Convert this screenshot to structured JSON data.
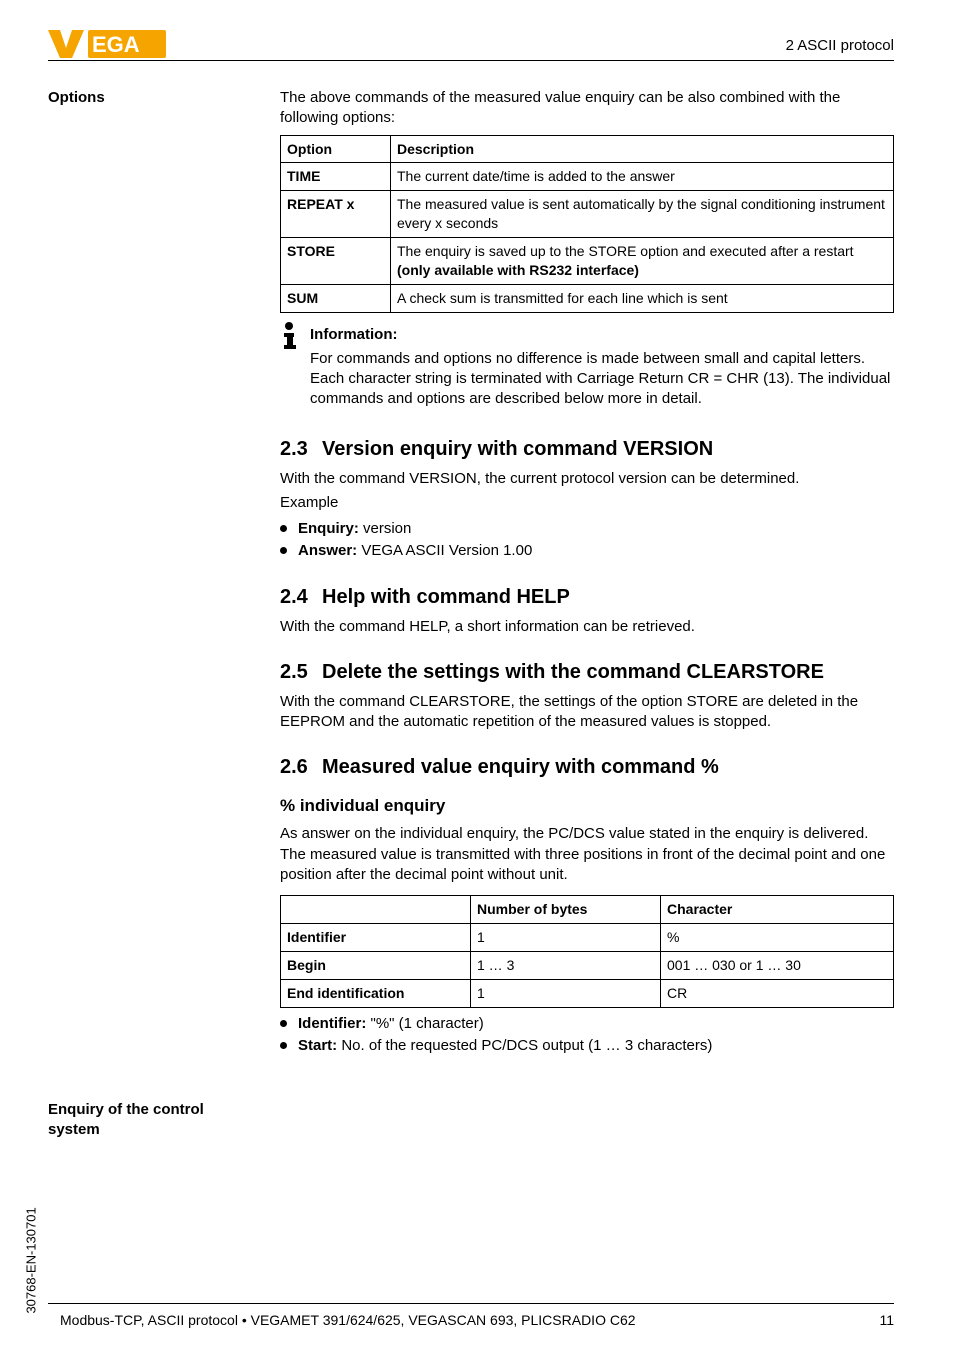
{
  "header": {
    "section_label": "2 ASCII protocol"
  },
  "doc_id": "30768-EN-130701",
  "margin": {
    "options": "Options",
    "enquiry": "Enquiry of the control system"
  },
  "options_intro": "The above commands of the measured value enquiry can be also combined with the following options:",
  "options_table": {
    "h1": "Option",
    "h2": "Description",
    "rows": [
      {
        "opt": "TIME",
        "desc": "The current date/time is added to the answer"
      },
      {
        "opt": "REPEAT x",
        "desc": "The measured value is sent automatically by the signal conditioning instrument every x seconds"
      },
      {
        "opt": "STORE",
        "desc": "The enquiry is saved up to the STORE option and executed after a restart (only available with RS232 interface)"
      },
      {
        "opt": "SUM",
        "desc": "A check sum is transmitted for each line which is sent"
      }
    ],
    "store_plain": "The enquiry is saved up to the STORE option and executed after a restart ",
    "store_bold": "(only available with RS232 interface)"
  },
  "info": {
    "heading": "Information:",
    "body": "For commands and options no difference is made between small and capital letters. Each character string is terminated with Carriage Return CR = CHR (13). The individual commands and options are described below more in detail."
  },
  "s23": {
    "num": "2.3",
    "title": "Version enquiry with command VERSION",
    "p1": "With the command VERSION, the current protocol version can be determined.",
    "p2": "Example",
    "b1_label": "Enquiry:",
    "b1_val": " version",
    "b2_label": "Answer:",
    "b2_val": " VEGA ASCII Version 1.00"
  },
  "s24": {
    "num": "2.4",
    "title": "Help with command HELP",
    "p1": "With the command HELP, a short information can be retrieved."
  },
  "s25": {
    "num": "2.5",
    "title": "Delete the settings with the command CLEARSTORE",
    "p1": "With the command CLEARSTORE, the settings of the option STORE are deleted in the EEPROM and the automatic repetition of the measured values is stopped."
  },
  "s26": {
    "num": "2.6",
    "title": "Measured value enquiry with command %",
    "sub": "% individual enquiry",
    "p1": "As answer on the individual enquiry, the PC/DCS value stated in the enquiry is delivered. The measured value is transmitted with three positions in front of the decimal point and one position after the decimal point without unit."
  },
  "enq_table": {
    "h_blank": "",
    "h2": "Number of bytes",
    "h3": "Character",
    "r1c1": "Identifier",
    "r1c2": "1",
    "r1c3": "%",
    "r2c1": "Begin",
    "r2c2": "1 … 3",
    "r2c3": "001 … 030 or 1 … 30",
    "r3c1": "End identification",
    "r3c2": "1",
    "r3c3": "CR"
  },
  "tail_bullets": {
    "b1_label": "Identifier:",
    "b1_val": " \"%\" (1 character)",
    "b2_label": "Start:",
    "b2_val": " No. of the requested PC/DCS output (1 … 3 characters)"
  },
  "footer": {
    "left": "Modbus-TCP, ASCII protocol • VEGAMET 391/624/625, VEGASCAN 693, PLICSRADIO C62",
    "right": "11"
  }
}
